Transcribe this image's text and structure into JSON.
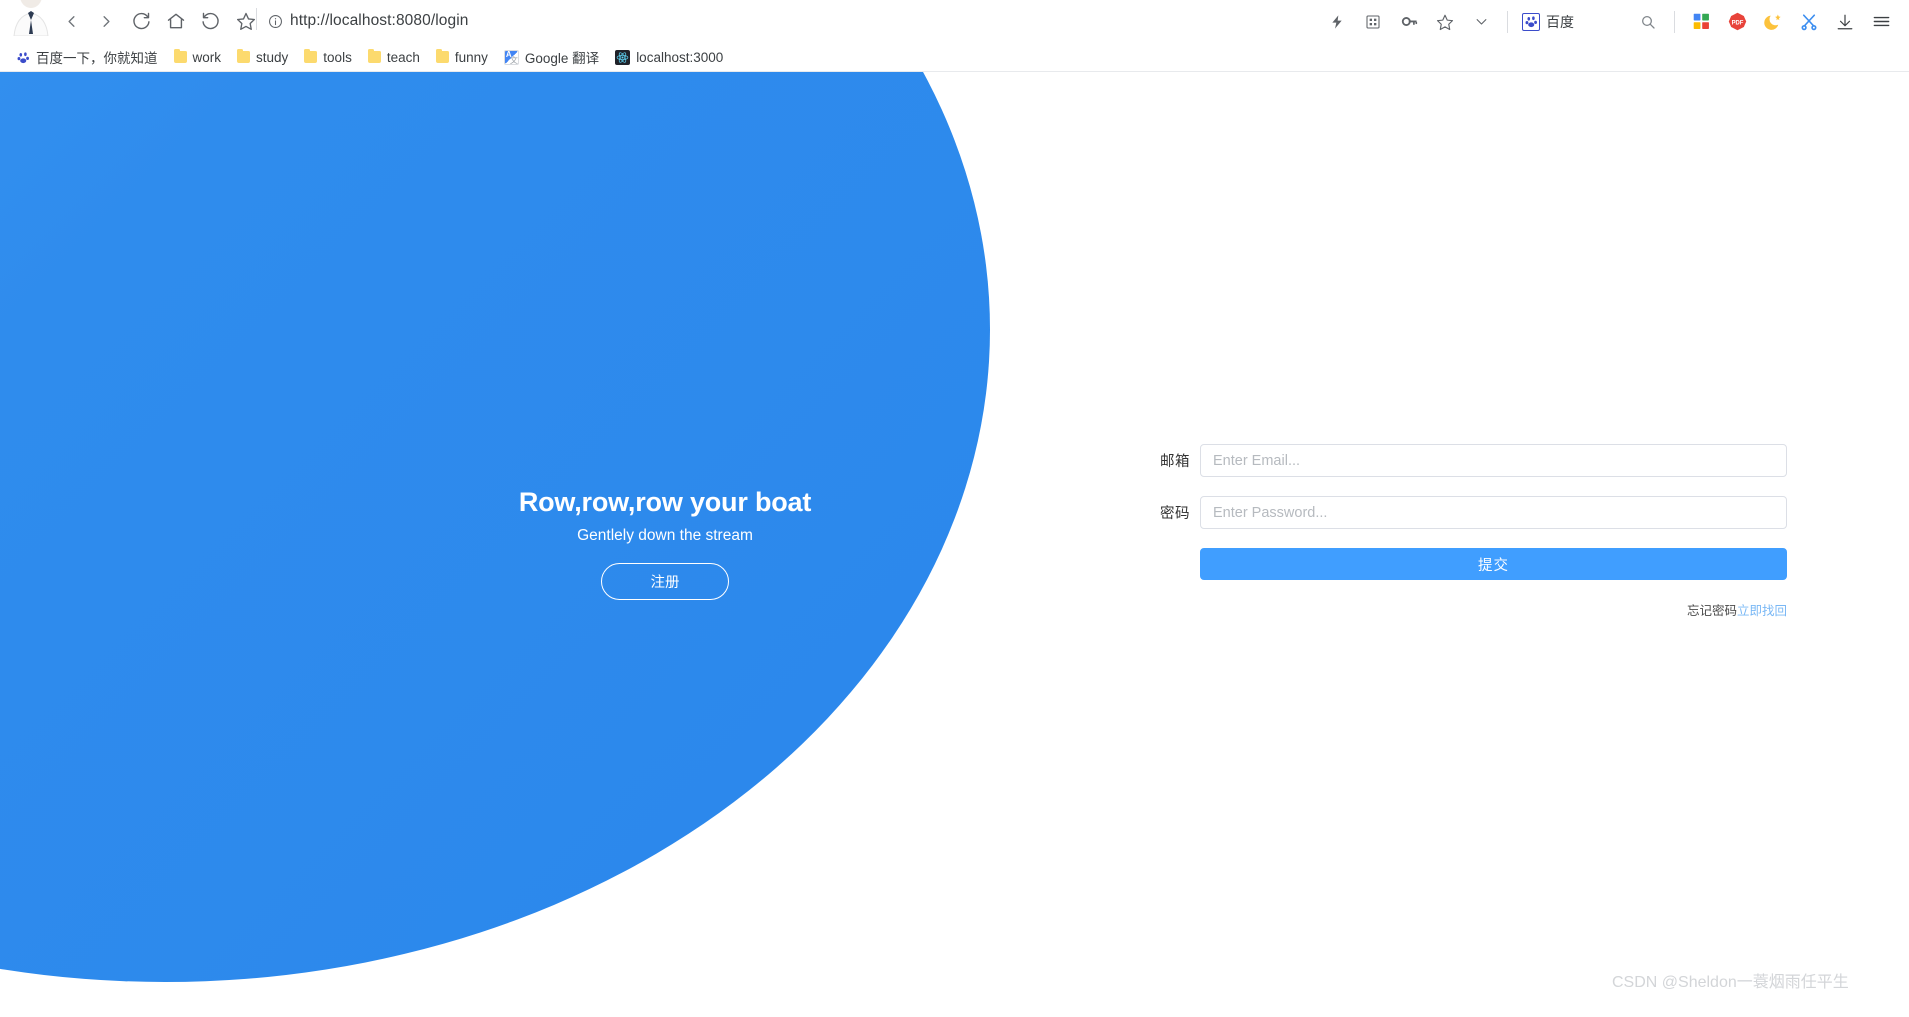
{
  "browser": {
    "avatar": "profile-avatar",
    "nav": [
      {
        "name": "back-button",
        "icon": "chevron-left-icon"
      },
      {
        "name": "forward-button",
        "icon": "chevron-right-icon"
      },
      {
        "name": "reload-button",
        "icon": "reload-icon"
      },
      {
        "name": "home-button",
        "icon": "home-icon"
      },
      {
        "name": "history-back-button",
        "icon": "undo-icon"
      },
      {
        "name": "bookmark-star-button",
        "icon": "star-icon"
      }
    ],
    "url": "http://localhost:8080/login",
    "url_info_icon": "info-circle-icon",
    "right_icons": [
      {
        "name": "lightning-button",
        "icon": "lightning-icon"
      },
      {
        "name": "grid-button",
        "icon": "grid-icon"
      },
      {
        "name": "password-key-button",
        "icon": "key-icon"
      },
      {
        "name": "favorite-star-button",
        "icon": "star-outline-icon"
      },
      {
        "name": "overflow-chevron-button",
        "icon": "chevron-down-icon"
      }
    ],
    "extension": {
      "label": "百度",
      "icon": "baidu-paw-icon"
    },
    "far_right_icons": [
      {
        "name": "search-button",
        "icon": "search-icon"
      },
      {
        "name": "apps-button",
        "icon": "apps-grid-icon"
      },
      {
        "name": "pdf-button",
        "icon": "pdf-icon"
      },
      {
        "name": "night-mode-button",
        "icon": "moon-icon"
      },
      {
        "name": "screenshot-button",
        "icon": "scissors-icon"
      },
      {
        "name": "downloads-button",
        "icon": "download-icon"
      },
      {
        "name": "menu-button",
        "icon": "hamburger-menu-icon"
      }
    ],
    "bookmarks": [
      {
        "label": "百度一下，你就知道",
        "icon": "baidu-paw-icon"
      },
      {
        "label": "work",
        "icon": "folder-icon"
      },
      {
        "label": "study",
        "icon": "folder-icon"
      },
      {
        "label": "tools",
        "icon": "folder-icon"
      },
      {
        "label": "teach",
        "icon": "folder-icon"
      },
      {
        "label": "funny",
        "icon": "folder-icon"
      },
      {
        "label": "Google 翻译",
        "icon": "google-translate-icon"
      },
      {
        "label": "localhost:3000",
        "icon": "react-icon"
      }
    ]
  },
  "hero": {
    "title": "Row,row,row your boat",
    "subtitle": "Gentlely down the stream",
    "register_label": "注册",
    "bg_color_start": "#3d9af3",
    "bg_color_end": "#2b87ec"
  },
  "login": {
    "email": {
      "label": "邮箱",
      "placeholder": "Enter Email...",
      "value": ""
    },
    "password": {
      "label": "密码",
      "placeholder": "Enter Password...",
      "value": ""
    },
    "submit_label": "提交",
    "submit_color": "#409eff",
    "forgot_text": "忘记密码",
    "forgot_link": "立即找回",
    "forgot_link_color": "#7ab8f5"
  },
  "watermark": "CSDN @Sheldon一蓑烟雨任平生"
}
